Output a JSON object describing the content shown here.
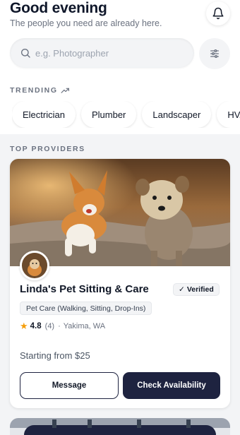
{
  "header": {
    "greeting": "Good evening",
    "subtitle": "The people you need are already here.",
    "notifications_icon": "bell-icon"
  },
  "search": {
    "placeholder": "e.g. Photographer",
    "value": "",
    "icon": "search-icon",
    "filter_icon": "sliders-icon"
  },
  "trending": {
    "label": "TRENDING",
    "icon": "trending-up-icon",
    "chips": [
      "Electrician",
      "Plumber",
      "Landscaper",
      "HVAC"
    ]
  },
  "providers": {
    "label": "TOP PROVIDERS",
    "cards": [
      {
        "name": "Linda's Pet Sitting & Care",
        "verified_label": "Verified",
        "category": "Pet Care (Walking, Sitting, Drop-Ins)",
        "rating": "4.8",
        "reviews": "(4)",
        "separator": "·",
        "location": "Yakima, WA",
        "price": "Starting from $25",
        "message_label": "Message",
        "check_label": "Check Availability"
      }
    ]
  },
  "colors": {
    "primary": "#1e2340",
    "star": "#f59e0b",
    "muted": "#6b7280",
    "section_bg": "#f3f4f6"
  }
}
